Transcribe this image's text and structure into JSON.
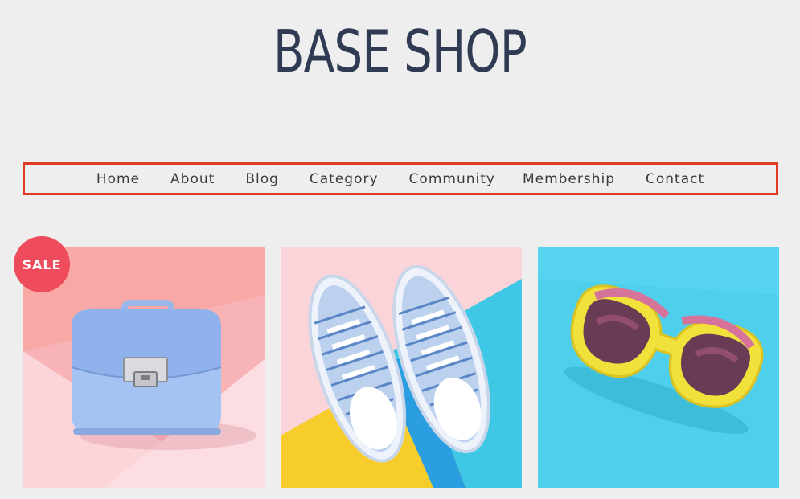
{
  "header": {
    "title": "BASE SHOP"
  },
  "nav": {
    "items": [
      {
        "label": "Home"
      },
      {
        "label": "About"
      },
      {
        "label": "Blog"
      },
      {
        "label": "Category"
      },
      {
        "label": "Community"
      },
      {
        "label": "Membership"
      },
      {
        "label": "Contact"
      }
    ],
    "border_color": "#e23b25"
  },
  "products": {
    "sale_badge": "SALE",
    "items": [
      {
        "image": "blue-handbag-photo",
        "on_sale": true
      },
      {
        "image": "striped-sneakers-photo",
        "on_sale": false
      },
      {
        "image": "yellow-sunglasses-photo",
        "on_sale": false
      }
    ]
  },
  "colors": {
    "background": "#eeeeee",
    "title": "#2f3a53",
    "badge": "#ee4b5c"
  }
}
